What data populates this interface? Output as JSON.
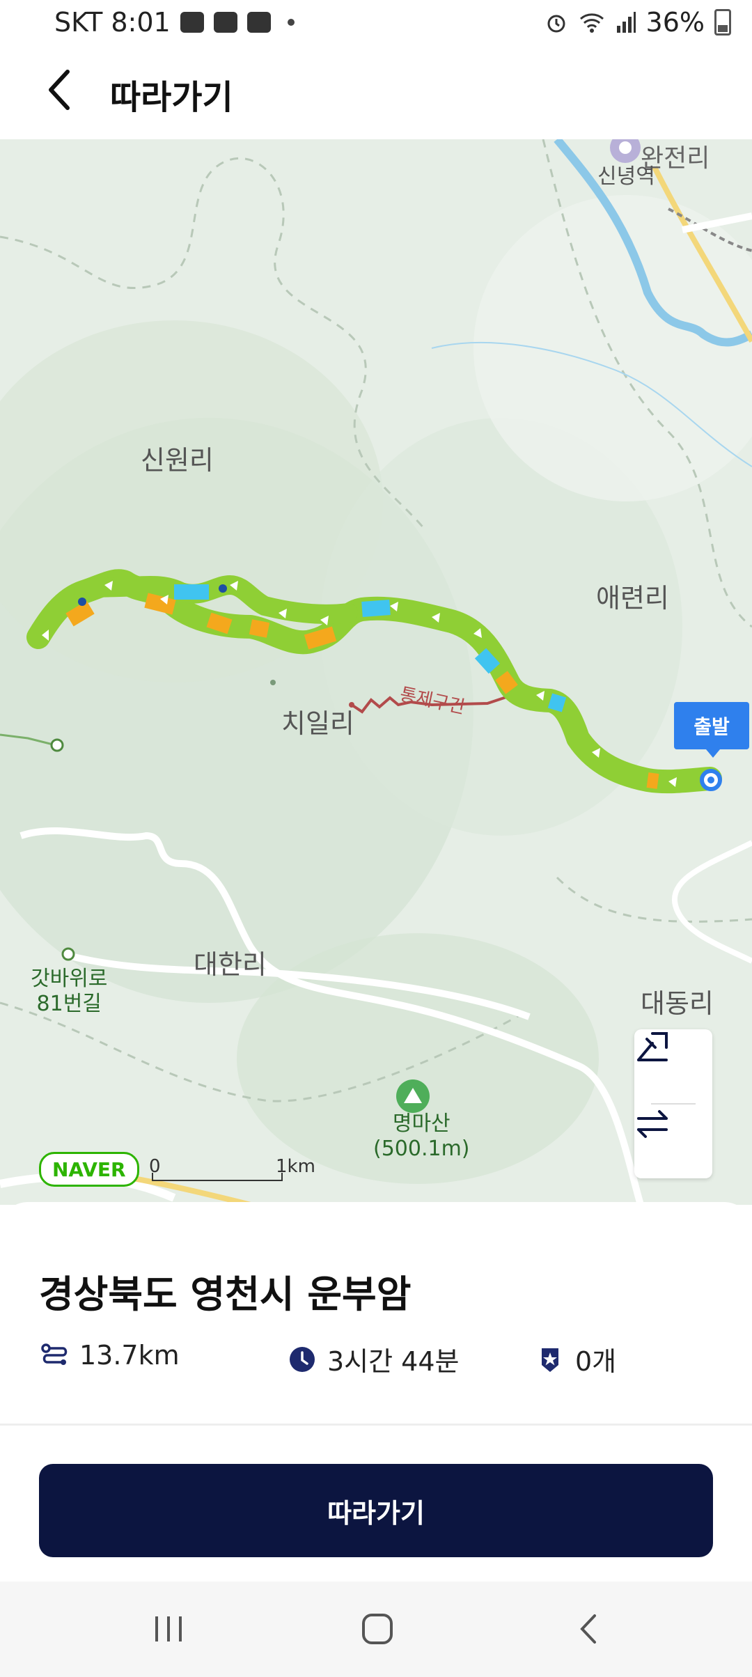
{
  "status_bar": {
    "carrier_time": "SKT 8:01",
    "battery": "36%"
  },
  "header": {
    "title": "따라가기"
  },
  "map": {
    "places": {
      "wanjeon": "완전리",
      "sinnyeong_station": "신녕역",
      "sinwon": "신원리",
      "aeryeon": "애련리",
      "chiil": "치일리",
      "daehan": "대한리",
      "daedong": "대동리",
      "gatbawi": "갓바위로\n81번길",
      "myeongmasan": "명마산\n(500.1m)",
      "restricted": "통제구간"
    },
    "start_label": "출발",
    "attribution": "NAVER",
    "scale": {
      "left": "0",
      "right": "1km"
    },
    "route_colors": {
      "green": "#8fcf35",
      "orange": "#f4a81d",
      "blue": "#40c4f0",
      "navy": "#1e4fa3"
    }
  },
  "sheet": {
    "location": "경상북도 영천시 운부암",
    "distance": "13.7km",
    "duration": "3시간 44분",
    "badges": "0개"
  },
  "buttons": {
    "follow": "따라가기"
  },
  "icons": {
    "back": "chevron-left-icon",
    "route": "route-icon",
    "clock": "clock-icon",
    "badge": "star-badge-icon",
    "elevation": "elevation-icon",
    "swap": "swap-arrows-icon"
  }
}
